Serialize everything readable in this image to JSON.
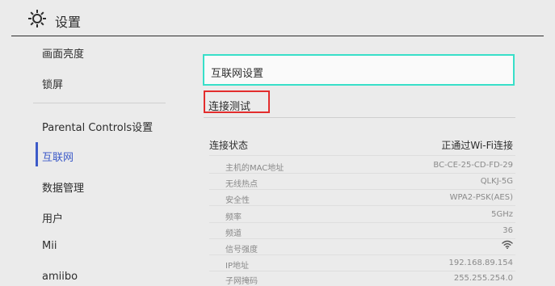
{
  "header": {
    "title": "设置",
    "icon": "gear-icon"
  },
  "sidebar": {
    "items": [
      {
        "label": "画面亮度"
      },
      {
        "label": "锁屏"
      },
      {
        "label": "Parental Controls设置"
      },
      {
        "label": "互联网",
        "active": true
      },
      {
        "label": "数据管理"
      },
      {
        "label": "用户"
      },
      {
        "label": "Mii"
      },
      {
        "label": "amiibo"
      }
    ]
  },
  "main": {
    "internet_settings": "互联网设置",
    "connection_test": "连接测试",
    "connection_status_label": "连接状态",
    "connection_status_value": "正通过Wi-Fi连接",
    "rows": [
      {
        "label": "主机的MAC地址",
        "value": "BC-CE-25-CD-FD-29"
      },
      {
        "label": "无线热点",
        "value": "QLKJ-5G"
      },
      {
        "label": "安全性",
        "value": "WPA2-PSK(AES)"
      },
      {
        "label": "频率",
        "value": "5GHz"
      },
      {
        "label": "频道",
        "value": "36"
      },
      {
        "label": "信号强度",
        "value": "wifi-icon"
      },
      {
        "label": "IP地址",
        "value": "192.168.89.154"
      },
      {
        "label": "子网掩码",
        "value": "255.255.254.0"
      }
    ]
  },
  "colors": {
    "accent_active": "#3c5ac8",
    "focus_border": "#38dfc9",
    "highlight_red": "#e32d2d"
  }
}
